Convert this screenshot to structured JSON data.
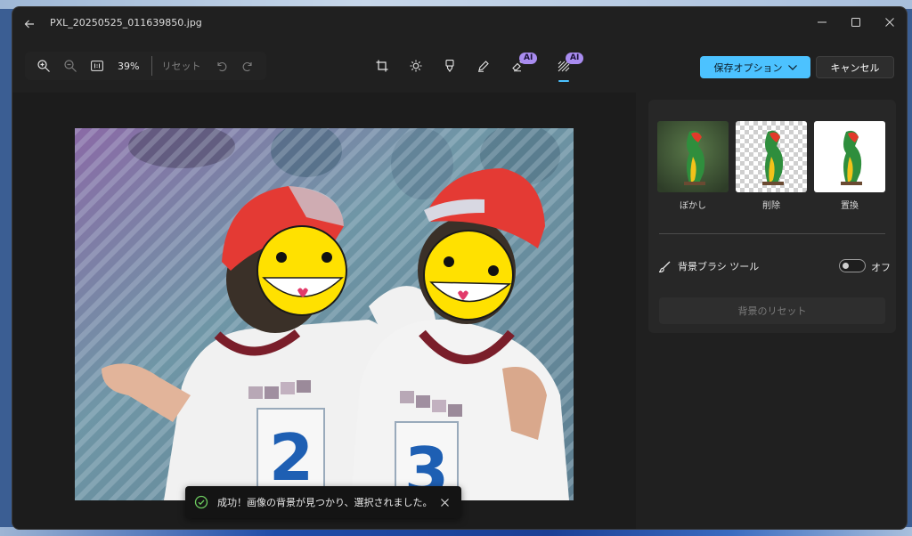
{
  "window": {
    "title": "PXL_20250525_011639850.jpg"
  },
  "toolbar": {
    "zoom_percent": "39%",
    "reset_label": "リセット",
    "save_label": "保存オプション",
    "cancel_label": "キャンセル",
    "ai_badge_1": "AI",
    "ai_badge_2": "AI"
  },
  "panel": {
    "options": [
      {
        "label": "ぼかし"
      },
      {
        "label": "削除"
      },
      {
        "label": "置換"
      }
    ],
    "brush_tool_label": "背景ブラシ ツール",
    "toggle_state_label": "オフ",
    "reset_background_label": "背景のリセット"
  },
  "toast": {
    "message": "成功！画像の背景が見つかり、選択されました。"
  },
  "colors": {
    "accent": "#4cc2ff",
    "ai_badge": "#a98cf0",
    "background": "#202020",
    "panel": "#272727"
  }
}
